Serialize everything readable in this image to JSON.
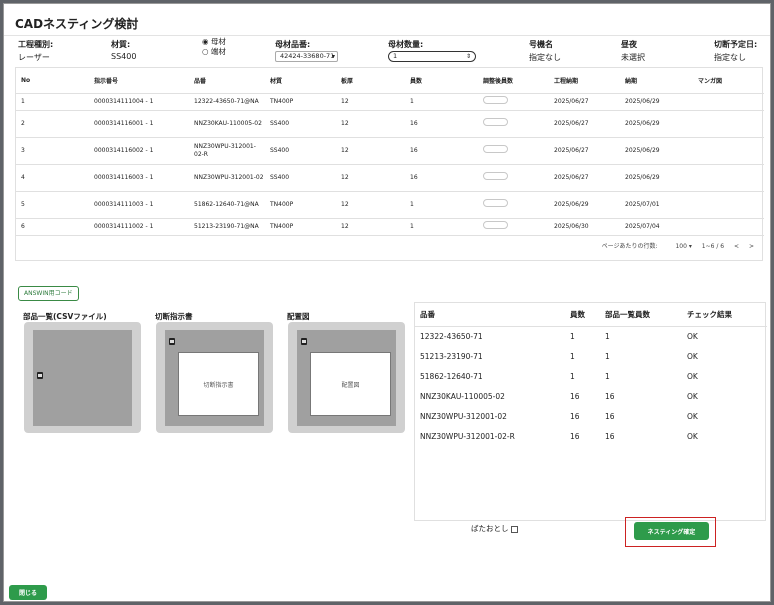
{
  "dialog": {
    "title": "CADネスティング検討"
  },
  "fields": {
    "process_type": {
      "label": "工程種別:",
      "value": "レーザー"
    },
    "material": {
      "label": "材質:",
      "value": "SS400"
    },
    "material_kind": {
      "option1": "◉ 母材",
      "option2": "○ 端材",
      "selected": "母材"
    },
    "base_part_no": {
      "label": "母材品番:",
      "value": "42424-33680-71"
    },
    "base_qty": {
      "label": "母材数量:",
      "value": "1"
    },
    "model": {
      "label": "号機名",
      "value": "指定なし"
    },
    "shift": {
      "label": "昼夜",
      "value": "未選択"
    },
    "cut_date": {
      "label": "切断予定日:",
      "value": "指定なし"
    }
  },
  "grid": {
    "headers": [
      "No",
      "指示番号",
      "品番",
      "材質",
      "板厚",
      "員数",
      "調整後員数",
      "工程納期",
      "納期",
      "マンガ図"
    ],
    "rows": [
      {
        "no": "1",
        "order": "0000314111004 - 1",
        "part": "12322-43650-71@NA",
        "material": "TN400P",
        "thickness": "12",
        "qty": "1",
        "process_due": "2025/06/27",
        "due": "2025/06/29"
      },
      {
        "no": "2",
        "order": "0000314116001 - 1",
        "part": "NNZ30KAU-110005-02",
        "material": "SS400",
        "thickness": "12",
        "qty": "16",
        "process_due": "2025/06/27",
        "due": "2025/06/29"
      },
      {
        "no": "3",
        "order": "0000314116002 - 1",
        "part": "NNZ30WPU-312001-02-R",
        "material": "SS400",
        "thickness": "12",
        "qty": "16",
        "process_due": "2025/06/27",
        "due": "2025/06/29"
      },
      {
        "no": "4",
        "order": "0000314116003 - 1",
        "part": "NNZ30WPU-312001-02",
        "material": "SS400",
        "thickness": "12",
        "qty": "16",
        "process_due": "2025/06/27",
        "due": "2025/06/29"
      },
      {
        "no": "5",
        "order": "0000314111003 - 1",
        "part": "51862-12640-71@NA",
        "material": "TN400P",
        "thickness": "12",
        "qty": "1",
        "process_due": "2025/06/29",
        "due": "2025/07/01"
      },
      {
        "no": "6",
        "order": "0000314111002 - 1",
        "part": "51213-23190-71@NA",
        "material": "TN400P",
        "thickness": "12",
        "qty": "1",
        "process_due": "2025/06/30",
        "due": "2025/07/04"
      }
    ],
    "pager": {
      "rows_label": "ページあたりの行数:",
      "rows_value": "100",
      "range": "1~6 / 6"
    }
  },
  "buttons": {
    "answin": "ANSWIN用コード",
    "nesting_confirm": "ネスティング確定",
    "close": "閉じる"
  },
  "panels": {
    "parts_csv": {
      "label": "部品一覧(CSVファイル)"
    },
    "cut_instruction": {
      "label": "切断指示書",
      "doc": "切断指示書"
    },
    "layout": {
      "label": "配置図",
      "doc": "配置図"
    }
  },
  "check_table": {
    "headers": [
      "品番",
      "員数",
      "部品一覧員数",
      "チェック結果"
    ],
    "rows": [
      {
        "part": "12322-43650-71",
        "qty": "1",
        "list_qty": "1",
        "result": "OK"
      },
      {
        "part": "51213-23190-71",
        "qty": "1",
        "list_qty": "1",
        "result": "OK"
      },
      {
        "part": "51862-12640-71",
        "qty": "1",
        "list_qty": "1",
        "result": "OK"
      },
      {
        "part": "NNZ30KAU-110005-02",
        "qty": "16",
        "list_qty": "16",
        "result": "OK"
      },
      {
        "part": "NNZ30WPU-312001-02",
        "qty": "16",
        "list_qty": "16",
        "result": "OK"
      },
      {
        "part": "NNZ30WPU-312001-02-R",
        "qty": "16",
        "list_qty": "16",
        "result": "OK"
      }
    ]
  },
  "bata": {
    "label": "ばたおとし"
  },
  "colors": {
    "primary": "#2e9b4b",
    "highlight": "#cc2222"
  }
}
